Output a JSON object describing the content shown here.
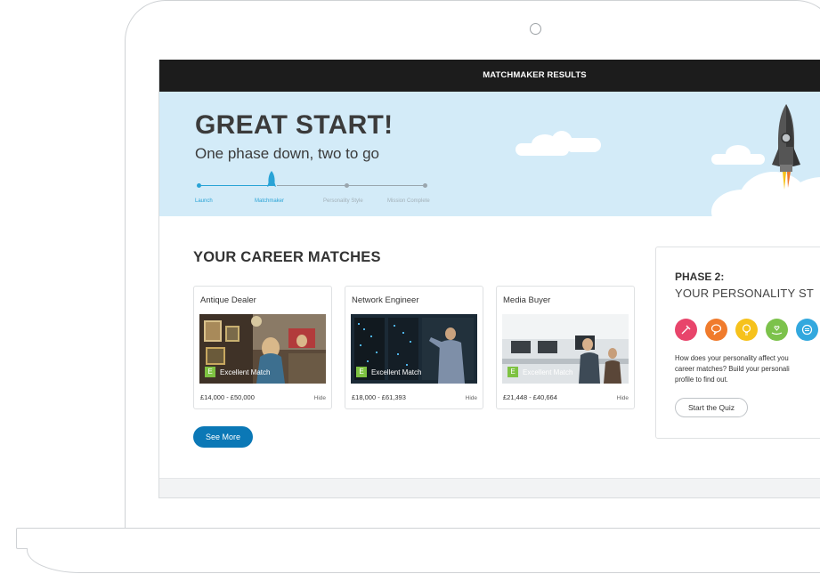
{
  "header": {
    "title": "MATCHMAKER RESULTS"
  },
  "hero": {
    "title": "GREAT START!",
    "subtitle": "One phase down, two to go",
    "steps": [
      {
        "label": "Launch",
        "state": "done"
      },
      {
        "label": "Matchmaker",
        "state": "current"
      },
      {
        "label": "Personality Style",
        "state": "pending"
      },
      {
        "label": "Mission Complete",
        "state": "pending"
      }
    ]
  },
  "matches": {
    "title": "YOUR CAREER MATCHES",
    "cards": [
      {
        "title": "Antique Dealer",
        "badge": "E",
        "match": "Excellent Match",
        "salary": "£14,000 - £50,000",
        "hide": "Hide"
      },
      {
        "title": "Network Engineer",
        "badge": "E",
        "match": "Excellent Match",
        "salary": "£18,000 - £61,393",
        "hide": "Hide"
      },
      {
        "title": "Media Buyer",
        "badge": "E",
        "match": "Excellent Match",
        "salary": "£21,448 - £40,664",
        "hide": "Hide"
      }
    ],
    "see_more": "See More"
  },
  "phase2": {
    "label": "PHASE 2:",
    "title": "YOUR PERSONALITY ST",
    "icons": [
      {
        "name": "hammer-icon",
        "color": "#e8456b"
      },
      {
        "name": "speech-bubble-icon",
        "color": "#f07b2c"
      },
      {
        "name": "lightbulb-icon",
        "color": "#f6c21c"
      },
      {
        "name": "hand-heart-icon",
        "color": "#7cc24b"
      },
      {
        "name": "chat-icon",
        "color": "#33a8de"
      }
    ],
    "text_line1": "How does your personality affect you",
    "text_line2": "career matches? Build your personali",
    "text_line3": "profile to find out.",
    "button": "Start the Quiz"
  },
  "colors": {
    "topbar": "#1c1c1c",
    "hero_bg": "#d3ebf8",
    "accent": "#0b78b6",
    "progress_active": "#29a3d6",
    "match_green": "#7ec242"
  }
}
